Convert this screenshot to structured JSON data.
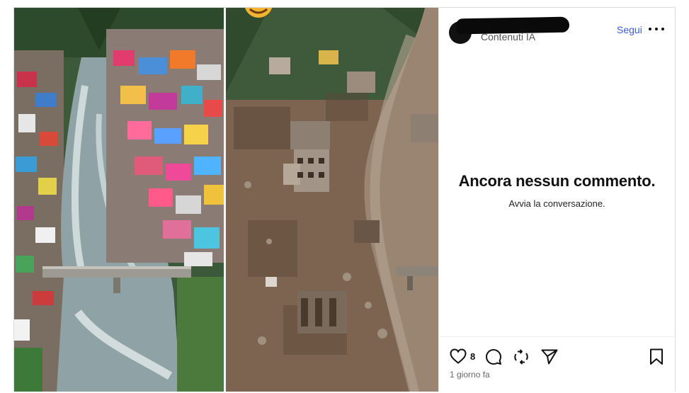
{
  "post": {
    "subtitle": "Contenuti IA",
    "follow_label": "Segui",
    "more_icon": "more-horizontal-icon"
  },
  "comments": {
    "empty_title": "Ancora nessun commento.",
    "empty_subtitle": "Avvia la conversazione."
  },
  "actions": {
    "like_icon": "heart-icon",
    "like_count": "8",
    "comment_icon": "comment-icon",
    "repost_icon": "repost-icon",
    "share_icon": "send-icon",
    "save_icon": "bookmark-icon"
  },
  "timestamp": "1 giorno fa"
}
